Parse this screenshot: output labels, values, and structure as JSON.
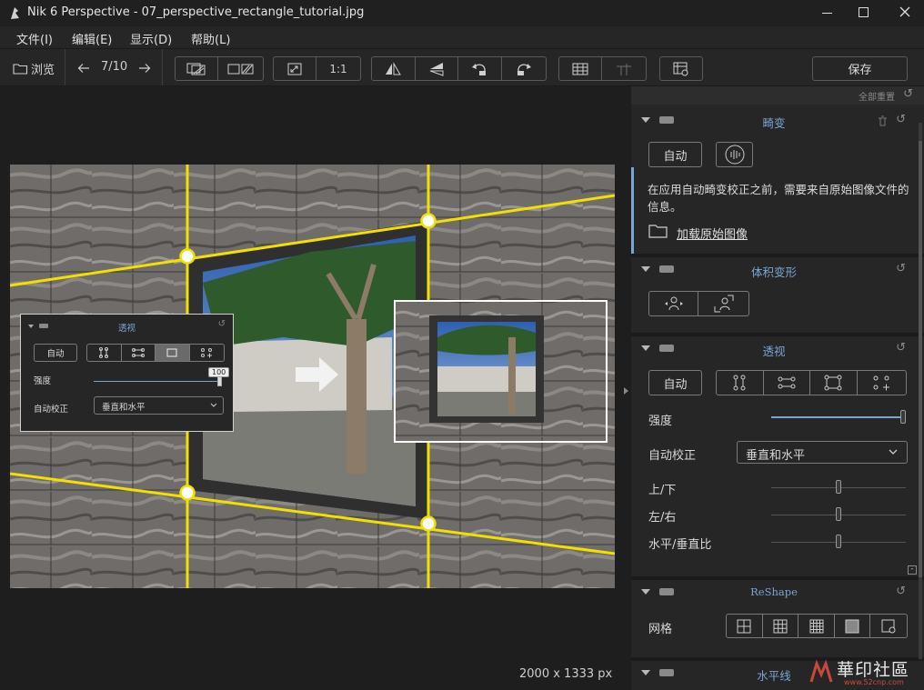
{
  "window": {
    "title": "Nik 6 Perspective - 07_perspective_rectangle_tutorial.jpg"
  },
  "menu": [
    {
      "label": "文件(I)"
    },
    {
      "label": "编辑(E)"
    },
    {
      "label": "显示(D)"
    },
    {
      "label": "帮助(L)"
    }
  ],
  "toolbar": {
    "browse_label": "浏览",
    "counter": "7/10",
    "zoom_1to1": "1:1",
    "save_label": "保存"
  },
  "canvas": {
    "image_size": "2000 x 1333 px"
  },
  "overlay": {
    "title": "透视",
    "auto_label": "自动",
    "strength_label": "强度",
    "strength_value": "100",
    "autocorrect_label": "自动校正",
    "autocorrect_value": "垂直和水平"
  },
  "panel": {
    "reset_all": "全部重置",
    "distortion": {
      "title": "畸变",
      "auto_label": "自动",
      "info_text": "在应用自动畸变校正之前，需要来自原始图像文件的信息。",
      "load_link": "加载原始图像"
    },
    "volume": {
      "title": "体积变形"
    },
    "perspective": {
      "title": "透视",
      "auto_label": "自动",
      "strength_label": "强度",
      "strength_value": 1.0,
      "autocorrect_label": "自动校正",
      "autocorrect_value": "垂直和水平",
      "updown_label": "上/下",
      "leftright_label": "左/右",
      "ratio_label": "水平/垂直比",
      "updown_value": 0.5,
      "leftright_value": 0.5,
      "ratio_value": 0.5
    },
    "reshape": {
      "title": "ReShape",
      "grid_label": "网格"
    },
    "horizon": {
      "title": "水平线"
    }
  },
  "watermark": {
    "text": "華印社區",
    "url": "www.52cnp.com"
  },
  "colors": {
    "accent": "#7aa4d4",
    "guide": "#f2e000",
    "background": "#1e1e1e",
    "panel": "#262626"
  }
}
